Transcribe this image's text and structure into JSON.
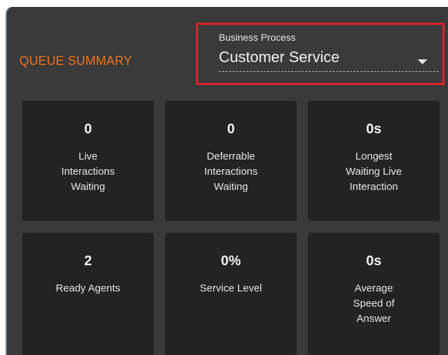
{
  "header": {
    "title": "QUEUE SUMMARY"
  },
  "business_process": {
    "label": "Business Process",
    "selected": "Customer Service",
    "icon": "chevron-down-icon"
  },
  "tiles": [
    {
      "value": "0",
      "label": "Live\nInteractions\nWaiting"
    },
    {
      "value": "0",
      "label": "Deferrable\nInteractions\nWaiting"
    },
    {
      "value": "0s",
      "label": "Longest\nWaiting Live\nInteraction"
    },
    {
      "value": "2",
      "label": "Ready Agents"
    },
    {
      "value": "0%",
      "label": "Service Level"
    },
    {
      "value": "0s",
      "label": "Average\nSpeed of\nAnswer"
    }
  ],
  "colors": {
    "title": "#f0721e",
    "highlight_border": "#e0202a",
    "panel": "#3a3a3a",
    "tile": "#232323"
  }
}
